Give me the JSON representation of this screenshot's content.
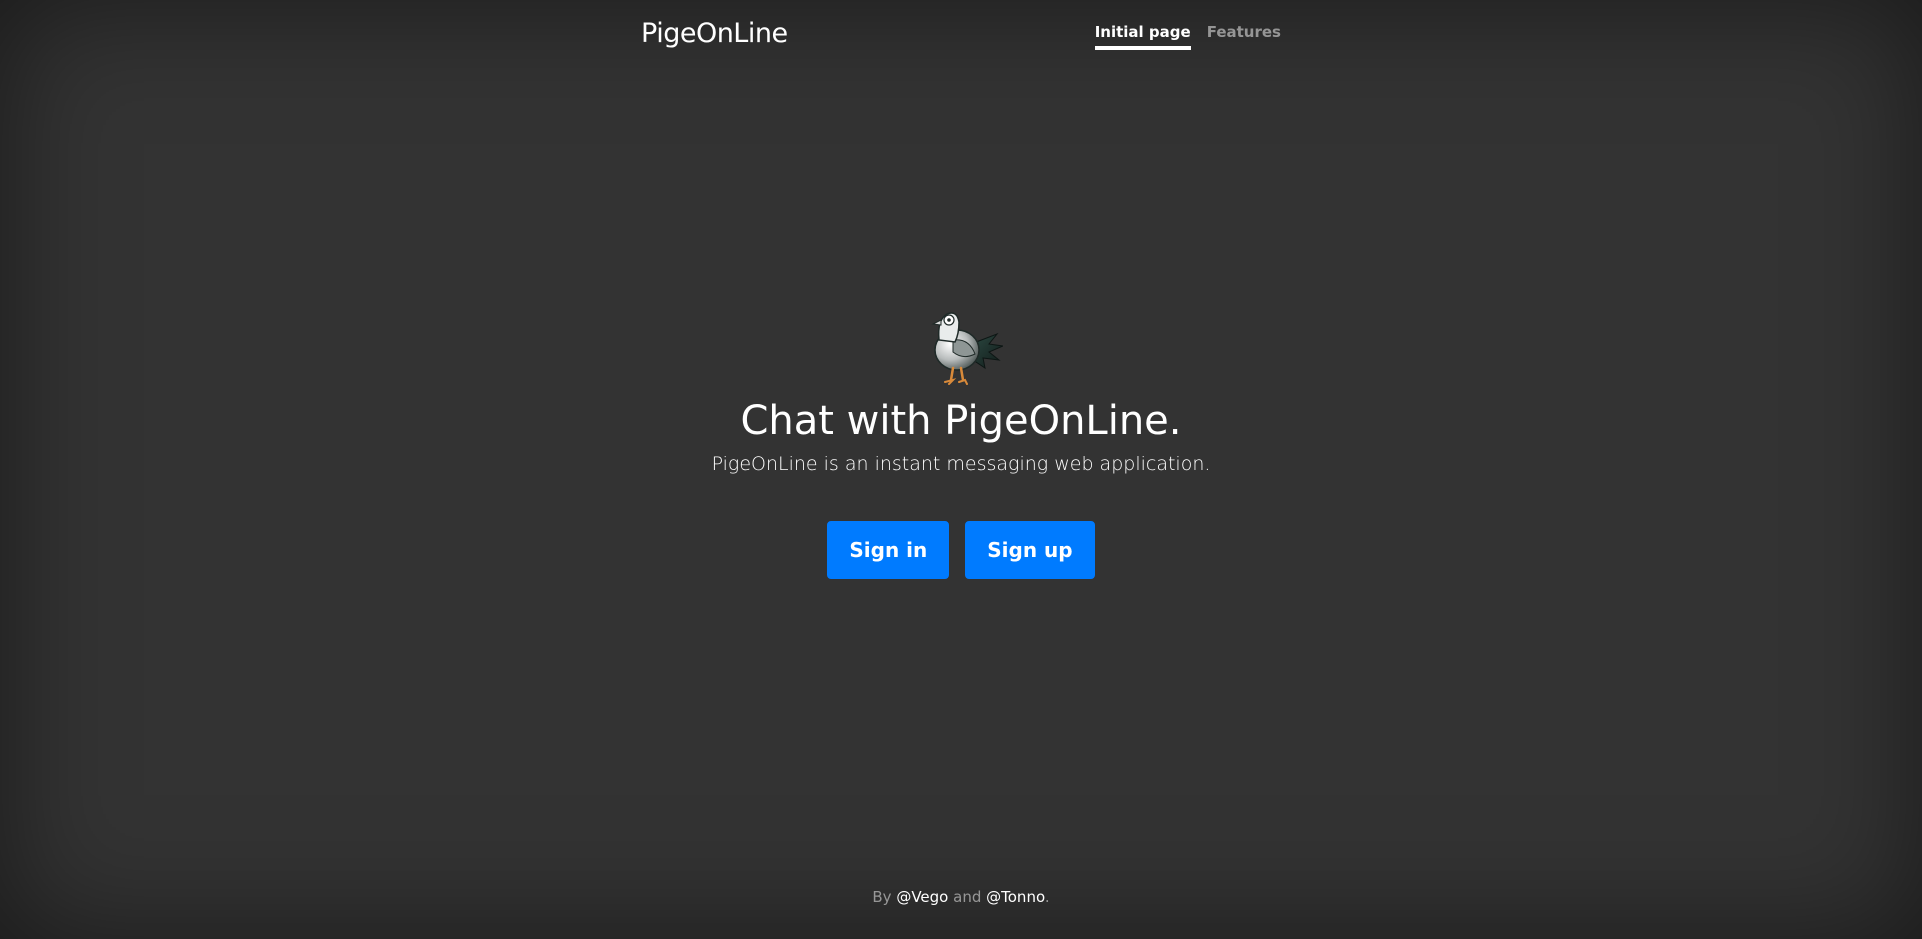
{
  "header": {
    "brand": "PigeOnLine",
    "nav": [
      {
        "label": "Initial page",
        "active": true
      },
      {
        "label": "Features",
        "active": false
      }
    ]
  },
  "cover": {
    "logo_icon": "pigeon-icon",
    "heading": "Chat with PigeOnLine.",
    "lead": "PigeOnLine is an instant messaging web application.",
    "buttons": {
      "sign_in": "Sign in",
      "sign_up": "Sign up"
    }
  },
  "footer": {
    "prefix": "By",
    "author1": "@Vego",
    "conjunction": "and",
    "author2": "@Tonno",
    "suffix": "."
  },
  "colors": {
    "background": "#333333",
    "accent": "#007bff",
    "text": "#ffffff"
  }
}
